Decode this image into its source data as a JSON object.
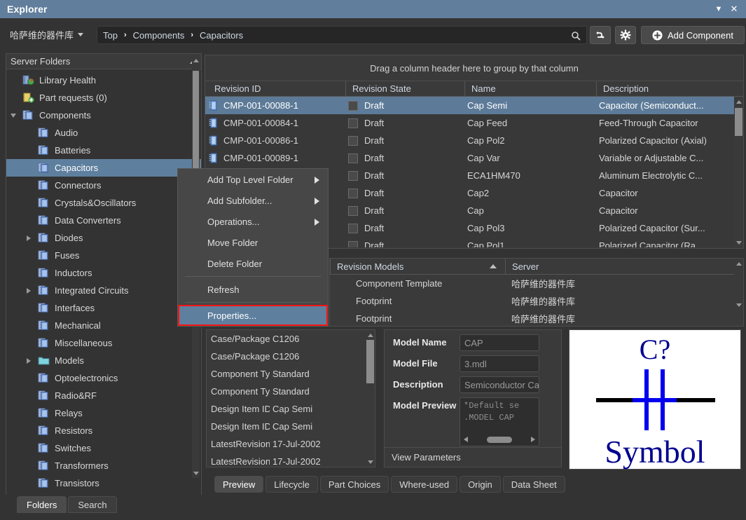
{
  "window": {
    "title": "Explorer",
    "dropdown_icon": "chevron-down-icon",
    "close_icon": "close-icon"
  },
  "toolbar": {
    "vendor": "哈萨维的器件库",
    "breadcrumb": [
      "Top",
      "Components",
      "Capacitors"
    ],
    "crumb_sep": "›",
    "search_icon": "search-icon",
    "sync_icon": "sync-icon",
    "gear_icon": "gear-icon",
    "add_component_label": "Add Component",
    "add_icon": "plus-circle-icon"
  },
  "sidebar": {
    "header": "Server Folders",
    "collapse_icon": "triangle-up-icon",
    "items": [
      {
        "label": "Library Health",
        "indent": 1,
        "expander": "none",
        "icon": "library-health-icon",
        "selected": false
      },
      {
        "label": "Part requests (0)",
        "indent": 1,
        "expander": "none",
        "icon": "part-request-icon",
        "selected": false
      },
      {
        "label": "Components",
        "indent": 1,
        "expander": "expanded",
        "icon": "folder-components-icon",
        "selected": false
      },
      {
        "label": "Audio",
        "indent": 2,
        "expander": "none",
        "icon": "folder-components-icon",
        "selected": false
      },
      {
        "label": "Batteries",
        "indent": 2,
        "expander": "none",
        "icon": "folder-components-icon",
        "selected": false
      },
      {
        "label": "Capacitors",
        "indent": 2,
        "expander": "none",
        "icon": "folder-components-icon",
        "selected": true
      },
      {
        "label": "Connectors",
        "indent": 2,
        "expander": "none",
        "icon": "folder-components-icon",
        "selected": false
      },
      {
        "label": "Crystals&Oscillators",
        "indent": 2,
        "expander": "none",
        "icon": "folder-components-icon",
        "selected": false
      },
      {
        "label": "Data Converters",
        "indent": 2,
        "expander": "none",
        "icon": "folder-components-icon",
        "selected": false
      },
      {
        "label": "Diodes",
        "indent": 2,
        "expander": "collapsed",
        "icon": "folder-components-icon",
        "selected": false
      },
      {
        "label": "Fuses",
        "indent": 2,
        "expander": "none",
        "icon": "folder-components-icon",
        "selected": false
      },
      {
        "label": "Inductors",
        "indent": 2,
        "expander": "none",
        "icon": "folder-components-icon",
        "selected": false
      },
      {
        "label": "Integrated Circuits",
        "indent": 2,
        "expander": "collapsed",
        "icon": "folder-components-icon",
        "selected": false
      },
      {
        "label": "Interfaces",
        "indent": 2,
        "expander": "none",
        "icon": "folder-components-icon",
        "selected": false
      },
      {
        "label": "Mechanical",
        "indent": 2,
        "expander": "none",
        "icon": "folder-components-icon",
        "selected": false
      },
      {
        "label": "Miscellaneous",
        "indent": 2,
        "expander": "none",
        "icon": "folder-components-icon",
        "selected": false
      },
      {
        "label": "Models",
        "indent": 2,
        "expander": "collapsed",
        "icon": "folder-plain-icon",
        "selected": false
      },
      {
        "label": "Optoelectronics",
        "indent": 2,
        "expander": "none",
        "icon": "folder-components-icon",
        "selected": false
      },
      {
        "label": "Radio&RF",
        "indent": 2,
        "expander": "none",
        "icon": "folder-components-icon",
        "selected": false
      },
      {
        "label": "Relays",
        "indent": 2,
        "expander": "none",
        "icon": "folder-components-icon",
        "selected": false
      },
      {
        "label": "Resistors",
        "indent": 2,
        "expander": "none",
        "icon": "folder-components-icon",
        "selected": false
      },
      {
        "label": "Switches",
        "indent": 2,
        "expander": "none",
        "icon": "folder-components-icon",
        "selected": false
      },
      {
        "label": "Transformers",
        "indent": 2,
        "expander": "none",
        "icon": "folder-components-icon",
        "selected": false
      },
      {
        "label": "Transistors",
        "indent": 2,
        "expander": "none",
        "icon": "folder-components-icon",
        "selected": false
      }
    ],
    "bottom_tabs": [
      {
        "label": "Folders",
        "active": true
      },
      {
        "label": "Search",
        "active": false
      }
    ]
  },
  "context_menu": {
    "items": [
      {
        "label": "Add Top Level Folder",
        "submenu": true,
        "highlighted": false,
        "separator_after": false
      },
      {
        "label": "Add Subfolder...",
        "submenu": true,
        "highlighted": false,
        "separator_after": false
      },
      {
        "label": "Operations...",
        "submenu": true,
        "highlighted": false,
        "separator_after": false
      },
      {
        "label": "Move Folder",
        "submenu": false,
        "highlighted": false,
        "separator_after": false
      },
      {
        "label": "Delete Folder",
        "submenu": false,
        "highlighted": false,
        "separator_after": true
      },
      {
        "label": "Refresh",
        "submenu": false,
        "highlighted": false,
        "separator_after": true
      },
      {
        "label": "Properties...",
        "submenu": false,
        "highlighted": true,
        "separator_after": false
      }
    ],
    "highlight_outline_color": "#f41414",
    "highlight_bg_color": "#5e7f9e"
  },
  "grid": {
    "group_hint": "Drag a column header here to group by that column",
    "columns": [
      "Revision ID",
      "Revision State",
      "Name",
      "Description"
    ],
    "rows": [
      {
        "revision_id": "CMP-001-00088-1",
        "state": "Draft",
        "name": "Cap Semi",
        "description": "Capacitor (Semiconduct...",
        "selected": true
      },
      {
        "revision_id": "CMP-001-00084-1",
        "state": "Draft",
        "name": "Cap Feed",
        "description": "Feed-Through Capacitor",
        "selected": false
      },
      {
        "revision_id": "CMP-001-00086-1",
        "state": "Draft",
        "name": "Cap Pol2",
        "description": "Polarized Capacitor (Axial)",
        "selected": false
      },
      {
        "revision_id": "CMP-001-00089-1",
        "state": "Draft",
        "name": "Cap Var",
        "description": "Variable or Adjustable C...",
        "selected": false
      },
      {
        "revision_id": "",
        "state": "Draft",
        "name": "ECA1HM470",
        "description": "Aluminum Electrolytic C...",
        "selected": false
      },
      {
        "revision_id": "",
        "state": "Draft",
        "name": "Cap2",
        "description": "Capacitor",
        "selected": false
      },
      {
        "revision_id": "",
        "state": "Draft",
        "name": "Cap",
        "description": "Capacitor",
        "selected": false
      },
      {
        "revision_id": "",
        "state": "Draft",
        "name": "Cap Pol3",
        "description": "Polarized Capacitor (Sur...",
        "selected": false
      },
      {
        "revision_id": "",
        "state": "Draft",
        "name": "Cap Pol1",
        "description": "Polarized Capacitor (Ra...",
        "selected": false
      }
    ]
  },
  "revision_models": {
    "columns": [
      "Revision Models",
      "Server"
    ],
    "sort_icon": "triangle-up-icon",
    "rows": [
      {
        "model": "Component Template",
        "server": "哈萨维的器件库"
      },
      {
        "model": "Footprint",
        "server": "哈萨维的器件库"
      },
      {
        "model": "Footprint",
        "server": "哈萨维的器件库"
      }
    ]
  },
  "parameters": [
    {
      "key": "Case/Package",
      "value": "C1206"
    },
    {
      "key": "Case/Package",
      "value": "C1206"
    },
    {
      "key": "Component Ty...",
      "value": "Standard"
    },
    {
      "key": "Component Ty...",
      "value": "Standard"
    },
    {
      "key": "Design Item ID",
      "value": "Cap Semi"
    },
    {
      "key": "Design Item ID",
      "value": "Cap Semi"
    },
    {
      "key": "LatestRevision...",
      "value": "17-Jul-2002"
    },
    {
      "key": "LatestRevision...",
      "value": "17-Jul-2002"
    }
  ],
  "model_detail": {
    "fields": [
      {
        "label": "Model Name",
        "value": "CAP"
      },
      {
        "label": "Model File",
        "value": "3.mdl"
      },
      {
        "label": "Description",
        "value": "Semiconductor Ca"
      }
    ],
    "preview_label": "Model Preview",
    "preview_lines": [
      "*Default se",
      ".MODEL CAP"
    ],
    "scroll_left_icon": "triangle-left-icon",
    "scroll_right_icon": "triangle-right-icon",
    "view_parameters_label": "View Parameters"
  },
  "symbol_preview": {
    "top_text": "C?",
    "bottom_text": "Symbol",
    "symbol_color": "#0000ee",
    "wire_color": "#000000",
    "text_color": "#00008f",
    "background": "#ffffff"
  },
  "bottom_tabs": [
    {
      "label": "Preview",
      "active": true
    },
    {
      "label": "Lifecycle",
      "active": false
    },
    {
      "label": "Part Choices",
      "active": false
    },
    {
      "label": "Where-used",
      "active": false
    },
    {
      "label": "Origin",
      "active": false
    },
    {
      "label": "Data Sheet",
      "active": false
    }
  ]
}
